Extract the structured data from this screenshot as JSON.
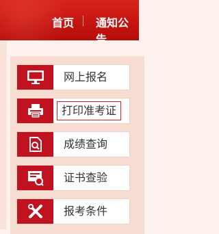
{
  "nav": {
    "home": "首页",
    "notice": "通知公告"
  },
  "menu": {
    "items": [
      {
        "label": "网上报名",
        "icon": "monitor-icon"
      },
      {
        "label": "打印准考证",
        "icon": "printer-icon"
      },
      {
        "label": "成绩查询",
        "icon": "document-search-icon"
      },
      {
        "label": "证书查验",
        "icon": "certificate-check-icon"
      },
      {
        "label": "报考条件",
        "icon": "tools-icon"
      }
    ],
    "active_index": 1
  },
  "colors": {
    "brand_red": "#c1121f",
    "nav_red": "#d7231c",
    "panel_bg": "#f7dcd2"
  }
}
